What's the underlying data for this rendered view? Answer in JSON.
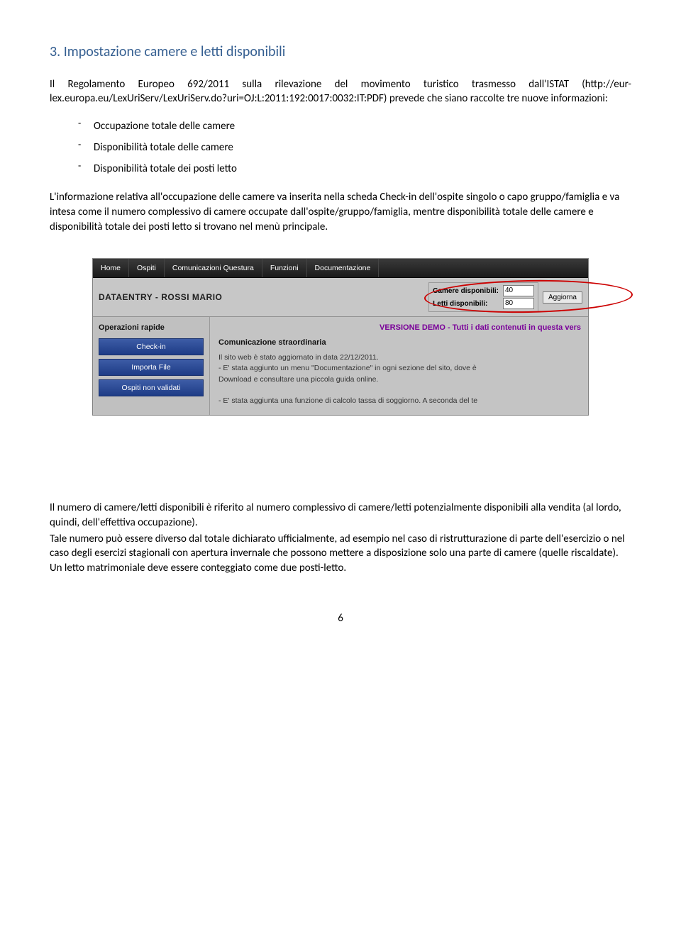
{
  "heading": "3. Impostazione camere e letti disponibili",
  "intro": "Il Regolamento Europeo 692/2011 sulla rilevazione del movimento turistico trasmesso dall'ISTAT (http://eur-lex.europa.eu/LexUriServ/LexUriServ.do?uri=OJ:L:2011:192:0017:0032:IT:PDF) prevede che siano raccolte tre nuove informazioni:",
  "bullets": [
    "Occupazione totale delle camere",
    "Disponibilità totale delle camere",
    "Disponibilità totale dei posti letto"
  ],
  "body1": "L'informazione relativa all'occupazione delle camere va inserita nella scheda Check-in dell'ospite singolo o capo gruppo/famiglia e va intesa come il numero complessivo di camere occupate dall'ospite/gruppo/famiglia, mentre disponibilità totale delle camere e disponibilità totale dei posti letto si trovano nel menù principale.",
  "body2": "Il numero di camere/letti disponibili è riferito al numero complessivo di camere/letti potenzialmente disponibili alla vendita (al lordo, quindi, dell'effettiva occupazione).",
  "body3": "Tale numero può essere diverso dal totale dichiarato ufficialmente, ad esempio nel caso di ristrutturazione di parte dell'esercizio o nel caso degli esercizi stagionali con apertura invernale che possono mettere a disposizione solo una parte di camere (quelle riscaldate). Un letto matrimoniale deve essere conteggiato come due posti-letto.",
  "screenshot": {
    "menu": [
      "Home",
      "Ospiti",
      "Comunicazioni Questura",
      "Funzioni",
      "Documentazione"
    ],
    "title": "DATAENTRY - ROSSI MARIO",
    "avail": {
      "camere_label": "Camere disponibili:",
      "camere_val": "40",
      "letti_label": "Letti disponibili:",
      "letti_val": "80",
      "aggiorna": "Aggiorna"
    },
    "sidebar": {
      "title": "Operazioni rapide",
      "btns": [
        "Check-in",
        "Importa File",
        "Ospiti non validati"
      ]
    },
    "content": {
      "version": "VERSIONE DEMO - Tutti i dati contenuti in questa vers",
      "comm_title": "Comunicazione straordinaria",
      "line1": "Il sito web è stato aggiornato in data 22/12/2011.",
      "line2": "- E' stata aggiunto un menu \"Documentazione\" in ogni sezione del sito, dove è",
      "line3": "Download e consultare una piccola guida online.",
      "line4": "- E' stata aggiunta una funzione di calcolo tassa di soggiorno. A seconda del te"
    }
  },
  "page_num": "6"
}
